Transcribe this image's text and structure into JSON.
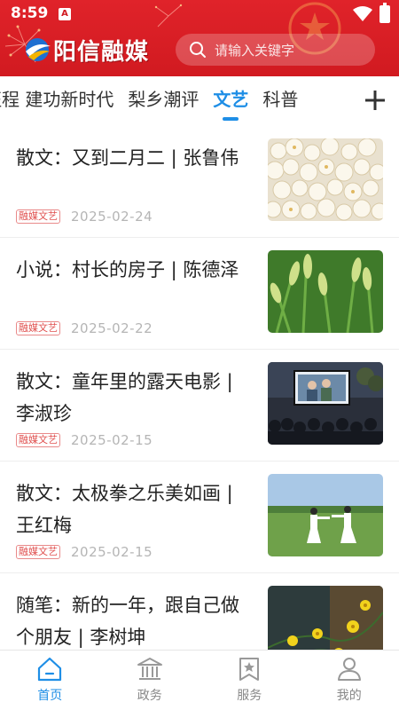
{
  "status_bar": {
    "time": "8:59",
    "notification": "A"
  },
  "header": {
    "logo_text": "阳信融媒",
    "search_placeholder": "请输入关键字"
  },
  "tabs": [
    {
      "label": "征程 建功新时代",
      "active": false
    },
    {
      "label": "梨乡潮评",
      "active": false
    },
    {
      "label": "文艺",
      "active": true
    },
    {
      "label": "科普",
      "active": false
    }
  ],
  "articles": [
    {
      "title": "散文：又到二月二 | 张鲁伟",
      "tag": "融媒文艺",
      "date": "2025-02-24",
      "thumb": "popcorn-photo"
    },
    {
      "title": "小说：村长的房子 | 陈德泽",
      "tag": "融媒文艺",
      "date": "2025-02-22",
      "thumb": "foxtail-grass-photo"
    },
    {
      "title": "散文：童年里的露天电影 | 李淑珍",
      "tag": "融媒文艺",
      "date": "2025-02-15",
      "thumb": "outdoor-cinema-photo"
    },
    {
      "title": "散文：太极拳之乐美如画 | 王红梅",
      "tag": "融媒文艺",
      "date": "2025-02-15",
      "thumb": "tai-chi-photo"
    },
    {
      "title": "随笔：新的一年，跟自己做个朋友 | 李树坤",
      "tag": "",
      "date": "",
      "thumb": "winter-jasmine-photo"
    }
  ],
  "bottom_nav": [
    {
      "label": "首页",
      "icon": "home-icon",
      "active": true
    },
    {
      "label": "政务",
      "icon": "government-building-icon",
      "active": false
    },
    {
      "label": "服务",
      "icon": "bookmark-star-icon",
      "active": false
    },
    {
      "label": "我的",
      "icon": "person-icon",
      "active": false
    }
  ],
  "colors": {
    "header_red": "#d11a20",
    "accent_blue": "#1e8ee6",
    "tag_red": "#e0504f"
  }
}
